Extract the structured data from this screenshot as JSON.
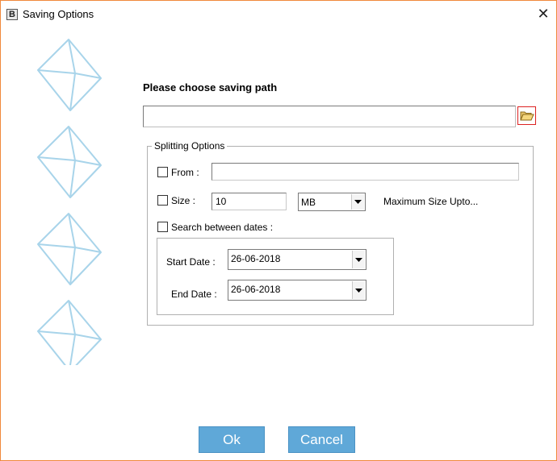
{
  "window": {
    "app_icon_letter": "B",
    "title": "Saving Options",
    "close_glyph": "✕"
  },
  "saving_path": {
    "heading": "Please choose saving path",
    "value": "",
    "browse_icon": "folder-open-icon"
  },
  "splitting": {
    "legend": "Splitting Options",
    "from": {
      "label": "From :",
      "checked": false,
      "value": ""
    },
    "size": {
      "label": "Size :",
      "checked": false,
      "value": "10",
      "unit": "MB",
      "note": "Maximum Size Upto..."
    },
    "dates": {
      "label": "Search between dates :",
      "checked": false,
      "start_label": "Start Date :",
      "start_value": "26-06-2018",
      "end_label": "End Date :",
      "end_value": "26-06-2018"
    }
  },
  "buttons": {
    "ok": "Ok",
    "cancel": "Cancel"
  },
  "colors": {
    "window_border": "#f0893c",
    "button_bg": "#5fa8d8",
    "envelope": "#a8d4ea"
  }
}
